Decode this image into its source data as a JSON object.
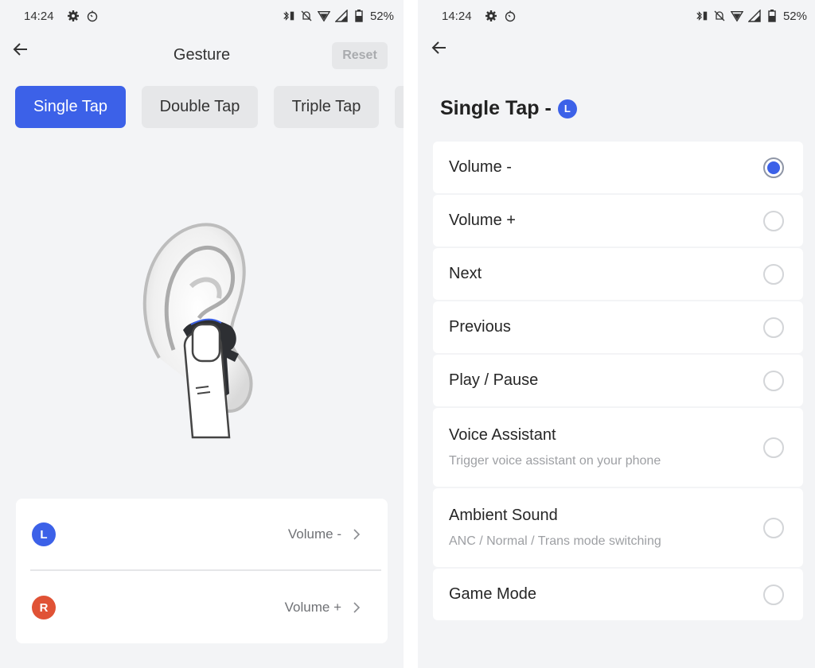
{
  "status_bar": {
    "time": "14:24",
    "battery": "52%",
    "icons": [
      "settings-gear-icon",
      "timer-icon",
      "bluetooth-battery-icon",
      "notifications-off-icon",
      "wifi-icon",
      "cellular-signal-icon",
      "battery-icon"
    ]
  },
  "gesture_screen": {
    "title": "Gesture",
    "reset_label": "Reset",
    "tabs": [
      {
        "label": "Single Tap",
        "active": true
      },
      {
        "label": "Double Tap",
        "active": false
      },
      {
        "label": "Triple Tap",
        "active": false
      },
      {
        "label": "",
        "active": false
      }
    ],
    "illustration": "finger-tapping-earbud-in-ear",
    "earbuds": [
      {
        "side": "L",
        "action": "Volume -",
        "color": "#3c61e8"
      },
      {
        "side": "R",
        "action": "Volume +",
        "color": "#e05235"
      }
    ]
  },
  "single_tap_screen": {
    "heading": "Single Tap -",
    "side_badge": "L",
    "options": [
      {
        "label": "Volume -",
        "subtitle": "",
        "selected": true
      },
      {
        "label": "Volume +",
        "subtitle": "",
        "selected": false
      },
      {
        "label": "Next",
        "subtitle": "",
        "selected": false
      },
      {
        "label": "Previous",
        "subtitle": "",
        "selected": false
      },
      {
        "label": "Play / Pause",
        "subtitle": "",
        "selected": false
      },
      {
        "label": "Voice Assistant",
        "subtitle": "Trigger voice assistant on your phone",
        "selected": false
      },
      {
        "label": "Ambient Sound",
        "subtitle": "ANC / Normal / Trans mode switching",
        "selected": false
      },
      {
        "label": "Game Mode",
        "subtitle": "",
        "selected": false
      }
    ]
  },
  "colors": {
    "accent": "#3c61e8",
    "right_earbud": "#e05235",
    "background": "#f3f4f6",
    "card": "#ffffff"
  }
}
